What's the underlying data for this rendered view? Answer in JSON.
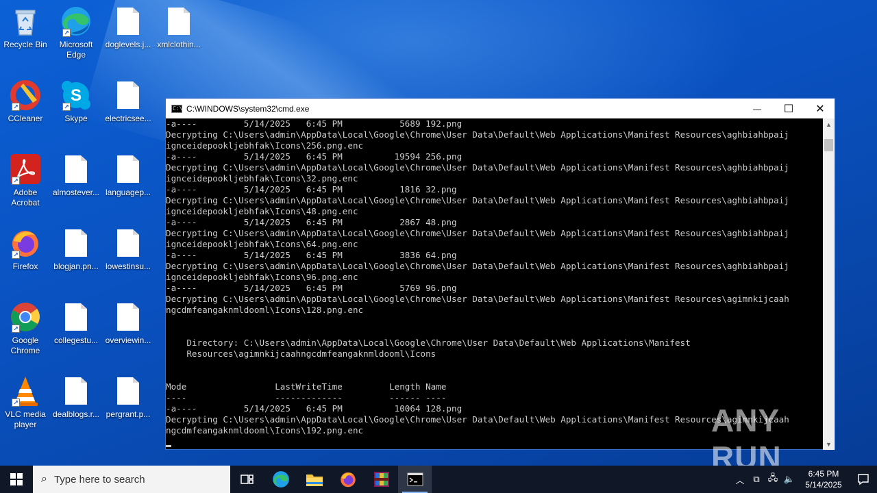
{
  "desktop": {
    "icons": [
      {
        "label": "Recycle Bin",
        "icon": "recycle-bin-icon"
      },
      {
        "label": "Microsoft Edge",
        "icon": "edge-icon"
      },
      {
        "label": "doglevels.j...",
        "icon": "file-icon"
      },
      {
        "label": "xmlclothin...",
        "icon": "file-icon"
      },
      {
        "label": "CCleaner",
        "icon": "ccleaner-icon"
      },
      {
        "label": "Skype",
        "icon": "skype-icon"
      },
      {
        "label": "electricsee...",
        "icon": "file-icon"
      },
      {
        "label": "Adobe Acrobat",
        "icon": "acrobat-icon"
      },
      {
        "label": "almostever...",
        "icon": "file-icon"
      },
      {
        "label": "languagep...",
        "icon": "file-icon"
      },
      {
        "label": "Firefox",
        "icon": "firefox-icon"
      },
      {
        "label": "blogjan.pn...",
        "icon": "file-icon"
      },
      {
        "label": "lowestinsu...",
        "icon": "file-icon"
      },
      {
        "label": "Google Chrome",
        "icon": "chrome-icon"
      },
      {
        "label": "collegestu...",
        "icon": "file-icon"
      },
      {
        "label": "overviewin...",
        "icon": "file-icon"
      },
      {
        "label": "VLC media player",
        "icon": "vlc-icon"
      },
      {
        "label": "dealblogs.r...",
        "icon": "file-icon"
      },
      {
        "label": "pergrant.p...",
        "icon": "file-icon"
      }
    ]
  },
  "cmd": {
    "title": "C:\\WINDOWS\\system32\\cmd.exe",
    "icon_text": "C:\\",
    "minimize": "—",
    "maximize": "☐",
    "close": "✕",
    "lines": [
      "-a----         5/14/2025   6:45 PM           5689 192.png",
      "Decrypting C:\\Users\\admin\\AppData\\Local\\Google\\Chrome\\User Data\\Default\\Web Applications\\Manifest Resources\\aghbiahbpaij",
      "igncei­depookljebhfak\\Icons\\256.png.enc",
      "-a----         5/14/2025   6:45 PM          19594 256.png",
      "Decrypting C:\\Users\\admin\\AppData\\Local\\Google\\Chrome\\User Data\\Default\\Web Applications\\Manifest Resources\\aghbiahbpaij",
      "igncei­depookljebhfak\\Icons\\32.png.enc",
      "-a----         5/14/2025   6:45 PM           1816 32.png",
      "Decrypting C:\\Users\\admin\\AppData\\Local\\Google\\Chrome\\User Data\\Default\\Web Applications\\Manifest Resources\\aghbiahbpaij",
      "igncei­depookljebhfak\\Icons\\48.png.enc",
      "-a----         5/14/2025   6:45 PM           2867 48.png",
      "Decrypting C:\\Users\\admin\\AppData\\Local\\Google\\Chrome\\User Data\\Default\\Web Applications\\Manifest Resources\\aghbiahbpaij",
      "igncei­depookljebhfak\\Icons\\64.png.enc",
      "-a----         5/14/2025   6:45 PM           3836 64.png",
      "Decrypting C:\\Users\\admin\\AppData\\Local\\Google\\Chrome\\User Data\\Default\\Web Applications\\Manifest Resources\\aghbiahbpaij",
      "igncei­depookljebhfak\\Icons\\96.png.enc",
      "-a----         5/14/2025   6:45 PM           5769 96.png",
      "Decrypting C:\\Users\\admin\\AppData\\Local\\Google\\Chrome\\User Data\\Default\\Web Applications\\Manifest Resources\\agimnkijcaah",
      "ngcdmfeangaknmldooml\\Icons\\128.png.enc",
      "",
      "",
      "    Directory: C:\\Users\\admin\\AppData\\Local\\Google\\Chrome\\User Data\\Default\\Web Applications\\Manifest",
      "    Resources\\agimnkijcaahngcdmfeangaknmldooml\\Icons",
      "",
      "",
      "Mode                 LastWriteTime         Length Name",
      "----                 -------------         ------ ----",
      "-a----         5/14/2025   6:45 PM          10064 128.png",
      "Decrypting C:\\Users\\admin\\AppData\\Local\\Google\\Chrome\\User Data\\Default\\Web Applications\\Manifest Resources\\agimnkijcaah",
      "ngcdmfeangaknmldooml\\Icons\\192.png.enc"
    ]
  },
  "watermark": "ANY RUN",
  "taskbar": {
    "search_placeholder": "Type here to search",
    "apps": [
      {
        "name": "task-view",
        "icon": "task-view-icon"
      },
      {
        "name": "edge",
        "icon": "edge-icon"
      },
      {
        "name": "file-explorer",
        "icon": "folder-icon"
      },
      {
        "name": "firefox",
        "icon": "firefox-icon"
      },
      {
        "name": "winrar",
        "icon": "winrar-icon"
      },
      {
        "name": "cmd",
        "icon": "cmd-icon"
      }
    ],
    "clock_time": "6:45 PM",
    "clock_date": "5/14/2025"
  }
}
